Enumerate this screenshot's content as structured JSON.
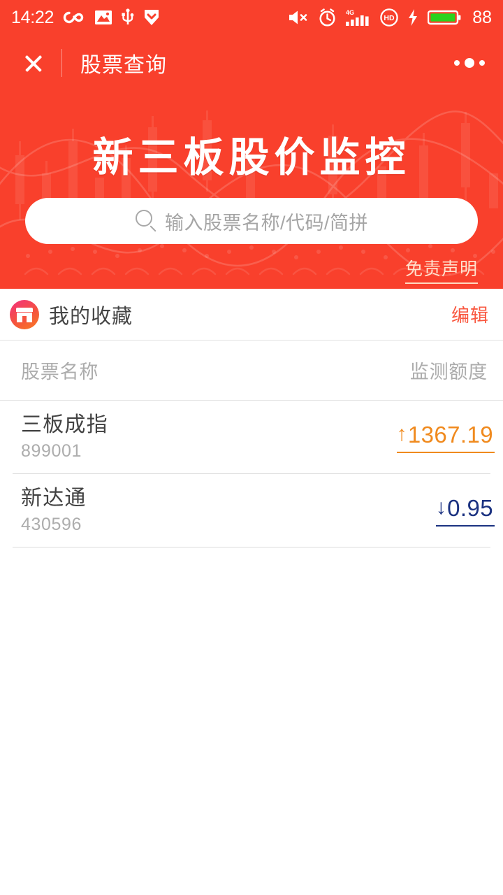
{
  "statusbar": {
    "time": "14:22",
    "battery_percent": "88",
    "left_icons": [
      "infinity-icon",
      "image-icon",
      "usb-icon",
      "shield-icon"
    ],
    "right_icons": [
      "mute-icon",
      "alarm-clock-icon",
      "signal-4g-icon",
      "hd-icon",
      "charging-bolt-icon",
      "battery-icon"
    ],
    "signal_label": "4G",
    "hd_label": "HD"
  },
  "titlebar": {
    "close_label": "close-icon",
    "title": "股票查询",
    "menu_label": "more-options"
  },
  "banner": {
    "heading": "新三板股价监控",
    "disclaimer": "免责声明"
  },
  "search": {
    "placeholder": "输入股票名称/代码/简拼",
    "value": ""
  },
  "favorites": {
    "icon": "shop-icon",
    "title": "我的收藏",
    "edit_label": "编辑"
  },
  "table": {
    "columns": [
      "股票名称",
      "监测额度"
    ],
    "rows": [
      {
        "name": "三板成指",
        "code": "899001",
        "value": "1367.19",
        "direction": "up",
        "arrow": "↑"
      },
      {
        "name": "新达通",
        "code": "430596",
        "value": "0.95",
        "direction": "down",
        "arrow": "↓"
      }
    ]
  },
  "colors": {
    "brand_red": "#F9402C",
    "up_orange": "#F08A1E",
    "down_navy": "#1B3281",
    "edit_red": "#F9573F",
    "muted_gray": "#ACACAC"
  }
}
